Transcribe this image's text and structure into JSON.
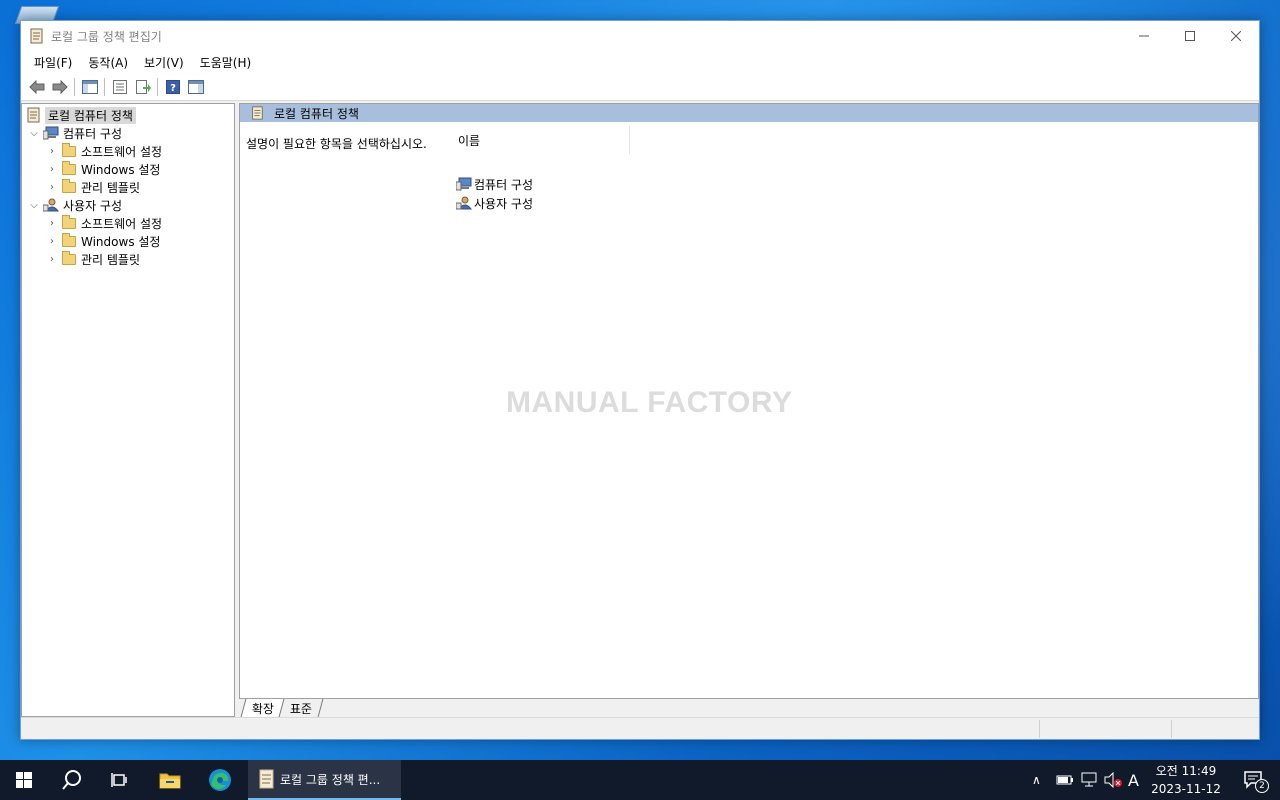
{
  "window": {
    "title": "로컬 그룹 정책 편집기"
  },
  "menu": [
    "파일(F)",
    "동작(A)",
    "보기(V)",
    "도움말(H)"
  ],
  "tree": {
    "root": "로컬 컴퓨터 정책",
    "computer": {
      "label": "컴퓨터 구성",
      "children": [
        "소프트웨어 설정",
        "Windows 설정",
        "관리 템플릿"
      ]
    },
    "user": {
      "label": "사용자 구성",
      "children": [
        "소프트웨어 설정",
        "Windows 설정",
        "관리 템플릿"
      ]
    }
  },
  "details": {
    "header": "로컬 컴퓨터 정책",
    "description": "설명이 필요한 항목을 선택하십시오.",
    "column_name": "이름",
    "items": [
      "컴퓨터 구성",
      "사용자 구성"
    ]
  },
  "watermark": "MANUAL FACTORY",
  "tabs": [
    "확장",
    "표준"
  ],
  "taskbar": {
    "app_label": "로컬 그룹 정책 편...",
    "clock_time": "오전 11:49",
    "clock_date": "2023-11-12",
    "ime": "A",
    "notification_count": "2"
  },
  "icons": {
    "back": "arrow-left-icon",
    "forward": "arrow-right-icon",
    "show_hide_tree": "console-tree-icon",
    "properties": "properties-icon",
    "export": "export-list-icon",
    "help": "help-icon",
    "view": "view-pane-icon"
  },
  "colors": {
    "header_bar": "#a7bfdd",
    "selection": "#d9d9d9",
    "taskbar": "#101a2a",
    "accent": "#76b9ed"
  }
}
